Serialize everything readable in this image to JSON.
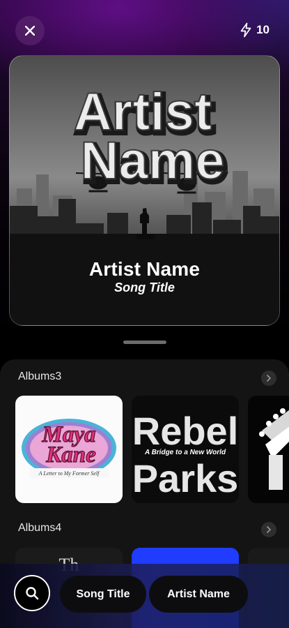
{
  "header": {
    "credits_count": "10"
  },
  "cover": {
    "big_title_line1": "Artist",
    "big_title_line2": "Name",
    "artist_name": "Artist Name",
    "song_title": "Song Title"
  },
  "sections": [
    {
      "title": "Albums3",
      "albums": [
        {
          "line1": "Maya",
          "line2": "Kane",
          "subtitle": "A Letter to My Former Self"
        },
        {
          "line1": "Rebel",
          "line2": "Parks",
          "subtitle": "A Bridge to a New World"
        },
        {
          "line1": "",
          "line2": "",
          "subtitle": ""
        }
      ]
    },
    {
      "title": "Albums4",
      "albums": [
        {
          "label": "Th"
        },
        {
          "label": ""
        },
        {
          "label": ""
        }
      ]
    }
  ],
  "bottom_bar": {
    "chips": [
      "Song Title",
      "Artist Name"
    ]
  },
  "colors": {
    "accent_purple": "#5e0f84",
    "sheet_bg": "#141414",
    "maya_pink": "#e0327a",
    "album4_blue": "#1f3cff"
  }
}
